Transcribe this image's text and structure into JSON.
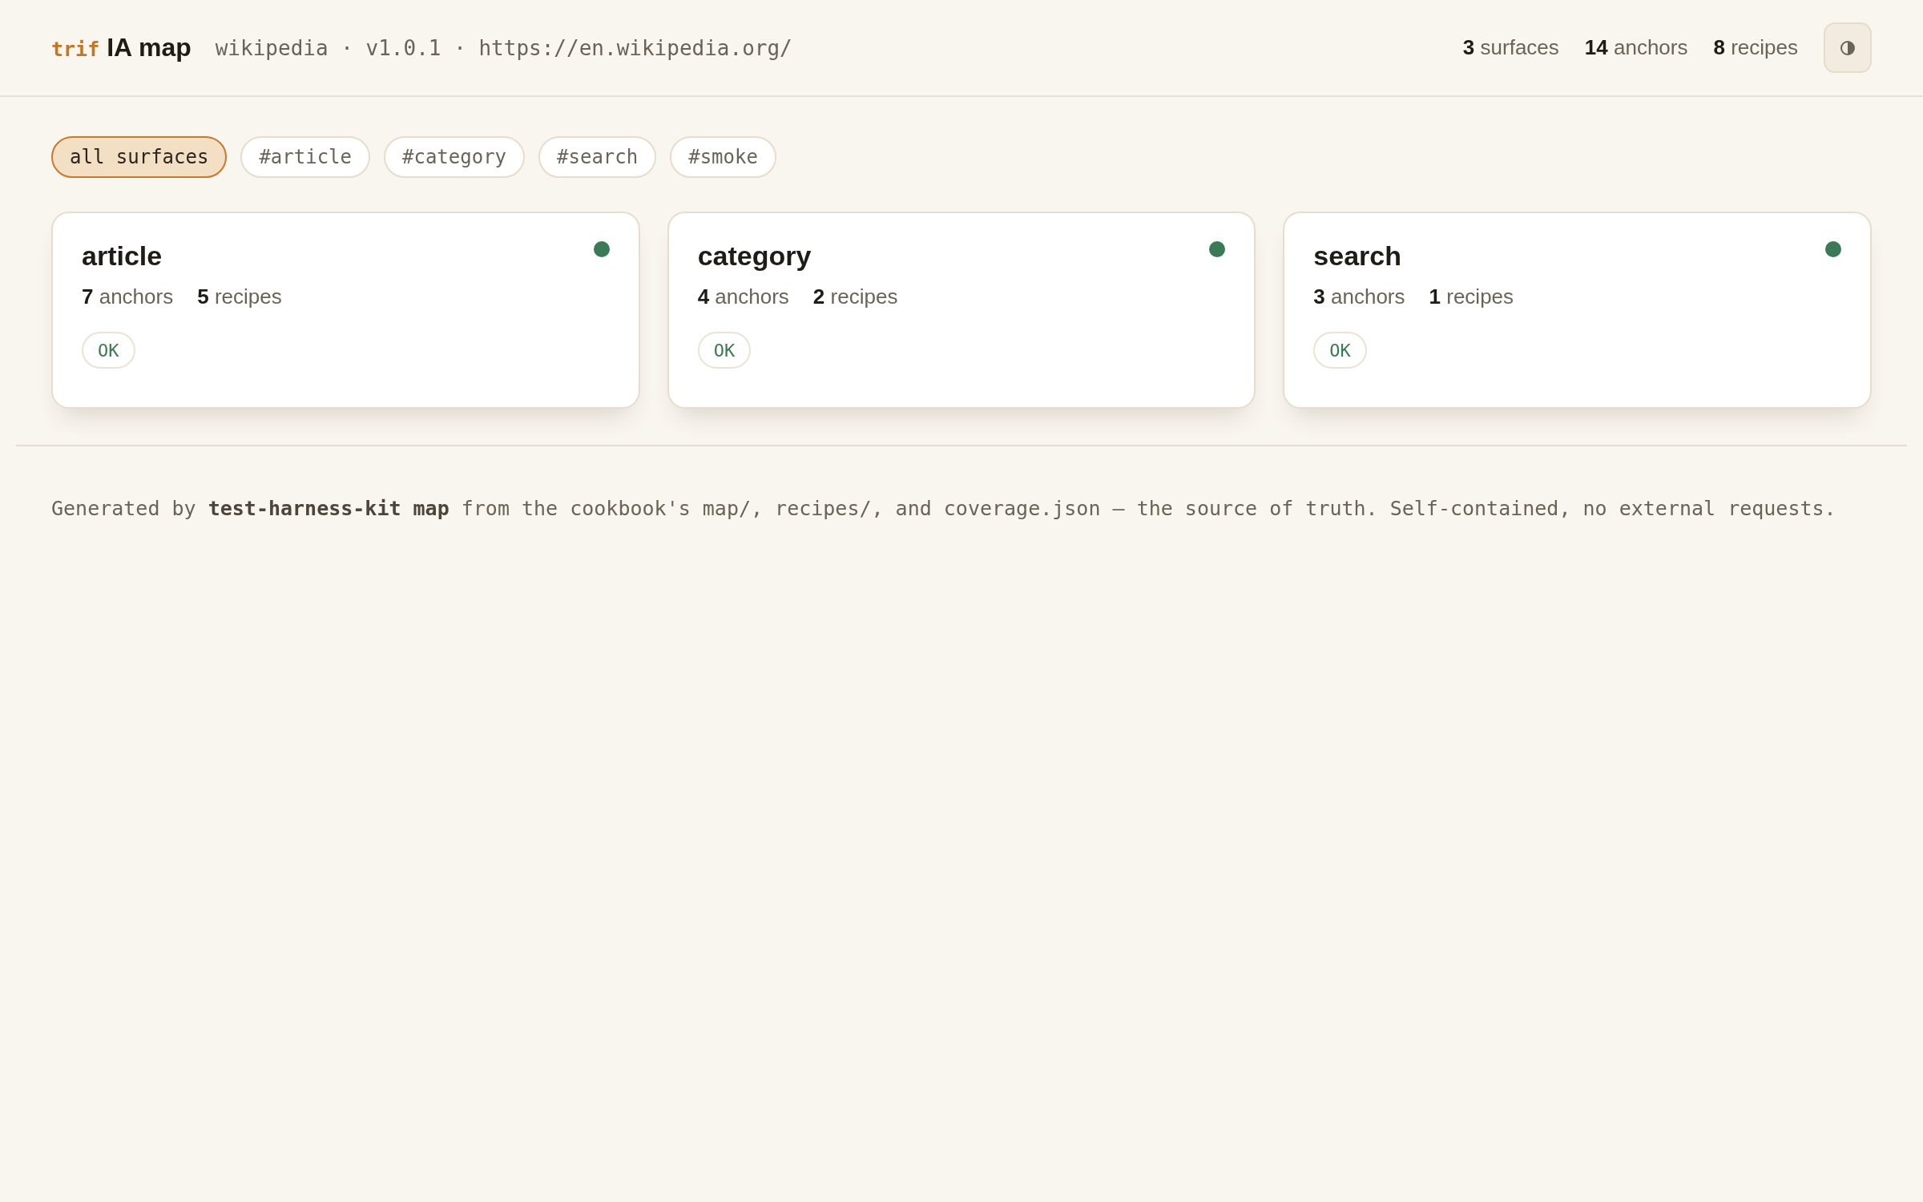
{
  "header": {
    "brand": {
      "mark": "trif",
      "title": "IA map"
    },
    "meta": "wikipedia · v1.0.1 · https://en.wikipedia.org/",
    "stats": [
      {
        "count": "3",
        "label": "surfaces"
      },
      {
        "count": "14",
        "label": "anchors"
      },
      {
        "count": "8",
        "label": "recipes"
      }
    ]
  },
  "filters": [
    {
      "label": "all surfaces",
      "selected": true
    },
    {
      "label": "#article",
      "selected": false
    },
    {
      "label": "#category",
      "selected": false
    },
    {
      "label": "#search",
      "selected": false
    },
    {
      "label": "#smoke",
      "selected": false
    }
  ],
  "surfaces": [
    {
      "name": "article",
      "color": "#3b7a57",
      "stats": [
        {
          "count": "7",
          "label": "anchors"
        },
        {
          "count": "5",
          "label": "recipes"
        }
      ],
      "status": "OK"
    },
    {
      "name": "category",
      "color": "#3b7a57",
      "stats": [
        {
          "count": "4",
          "label": "anchors"
        },
        {
          "count": "2",
          "label": "recipes"
        }
      ],
      "status": "OK"
    },
    {
      "name": "search",
      "color": "#3b7a57",
      "stats": [
        {
          "count": "3",
          "label": "anchors"
        },
        {
          "count": "1",
          "label": "recipes"
        }
      ],
      "status": "OK"
    }
  ],
  "footer": {
    "text": "Generated by **test-harness-kit map** from the cookbook's map/, recipes/, and coverage.json — the source of truth. Self-contained, no external requests."
  }
}
